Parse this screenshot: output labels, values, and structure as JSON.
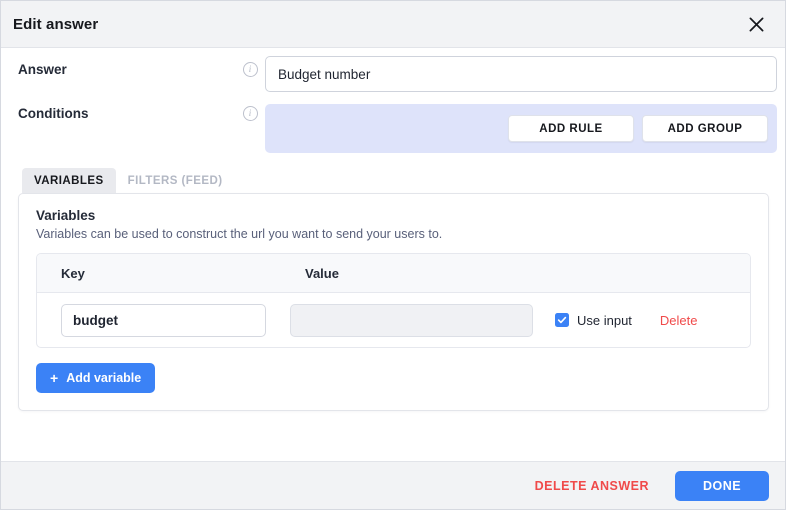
{
  "dialog": {
    "title": "Edit answer",
    "close_icon": "close-icon"
  },
  "fields": {
    "answer": {
      "label": "Answer",
      "info_icon": "info-icon",
      "value": "Budget number",
      "placeholder": ""
    },
    "conditions": {
      "label": "Conditions",
      "info_icon": "info-icon",
      "add_rule_label": "ADD RULE",
      "add_group_label": "ADD GROUP",
      "panel_color": "#dee3fa"
    }
  },
  "tabs": [
    {
      "label": "VARIABLES",
      "active": true
    },
    {
      "label": "FILTERS (FEED)",
      "active": false
    }
  ],
  "panel": {
    "title": "Variables",
    "description": "Variables can be used to construct the url you want to send your users to.",
    "table": {
      "columns": [
        "Key",
        "Value"
      ],
      "rows": [
        {
          "key": "budget",
          "value": "",
          "value_placeholder": "",
          "use_input_label": "Use input",
          "use_input_checked": true,
          "delete_label": "Delete"
        }
      ]
    },
    "add_variable_label": "Add variable",
    "add_variable_plus": "+"
  },
  "footer": {
    "delete_answer_label": "DELETE ANSWER",
    "done_label": "DONE"
  },
  "colors": {
    "accent_blue": "#3b82f6",
    "danger_red": "#f04a4a",
    "conditions_bg": "#dee3fa",
    "header_bg": "#f2f3f5"
  }
}
